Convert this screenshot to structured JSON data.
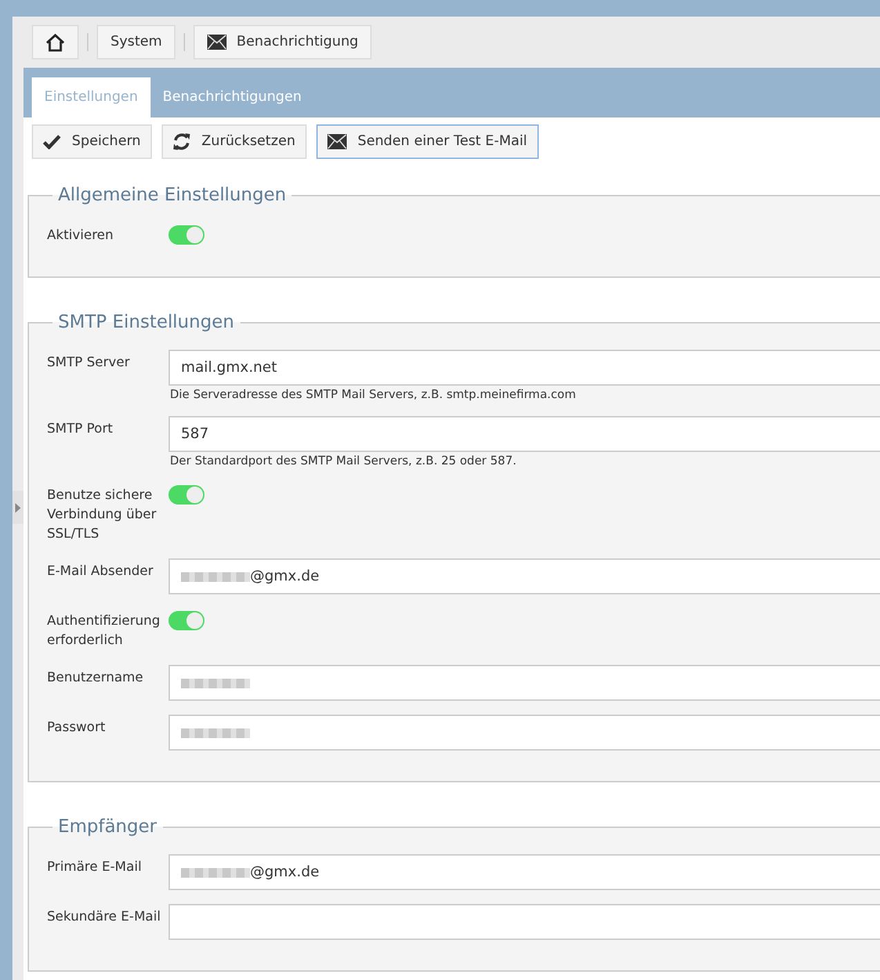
{
  "breadcrumb": [
    {
      "kind": "home"
    },
    {
      "kind": "text",
      "label": "System"
    },
    {
      "kind": "mail",
      "label": "Benachrichtigung"
    }
  ],
  "tabs": [
    {
      "label": "Einstellungen",
      "selected": true
    },
    {
      "label": "Benachrichtigungen",
      "selected": false
    }
  ],
  "toolbar": [
    {
      "kind": "save",
      "label": "Speichern",
      "focused": false
    },
    {
      "kind": "reset",
      "label": "Zurücksetzen",
      "focused": false
    },
    {
      "kind": "send",
      "label": "Senden einer Test E-Mail",
      "focused": true
    }
  ],
  "sections": [
    {
      "title": "Allgemeine Einstellungen",
      "rows": [
        {
          "kind": "toggle",
          "label": "Aktivieren",
          "on": true
        }
      ]
    },
    {
      "title": "SMTP Einstellungen",
      "rows": [
        {
          "kind": "text",
          "label": "SMTP Server",
          "value": "mail.gmx.net",
          "hint": "Die Serveradresse des SMTP Mail Servers, z.B. smtp.meinefirma.com"
        },
        {
          "kind": "text",
          "label": "SMTP Port",
          "value": "587",
          "hint": "Der Standardport des SMTP Mail Servers, z.B. 25 oder 587."
        },
        {
          "kind": "toggle",
          "label": "Benutze sichere Verbindung über SSL/TLS",
          "on": true
        },
        {
          "kind": "text",
          "label": "E-Mail Absender",
          "redacted": true,
          "value": "@gmx.de"
        },
        {
          "kind": "toggle",
          "label": "Authentifizierung erforderlich",
          "on": true
        },
        {
          "kind": "text",
          "label": "Benutzername",
          "redacted": true
        },
        {
          "kind": "text",
          "label": "Passwort",
          "redacted": true
        }
      ]
    },
    {
      "title": "Empfänger",
      "rows": [
        {
          "kind": "text",
          "label": "Primäre E-Mail",
          "redacted": true,
          "value": "@gmx.de"
        },
        {
          "kind": "text",
          "label": "Sekundäre E-Mail"
        }
      ]
    }
  ]
}
